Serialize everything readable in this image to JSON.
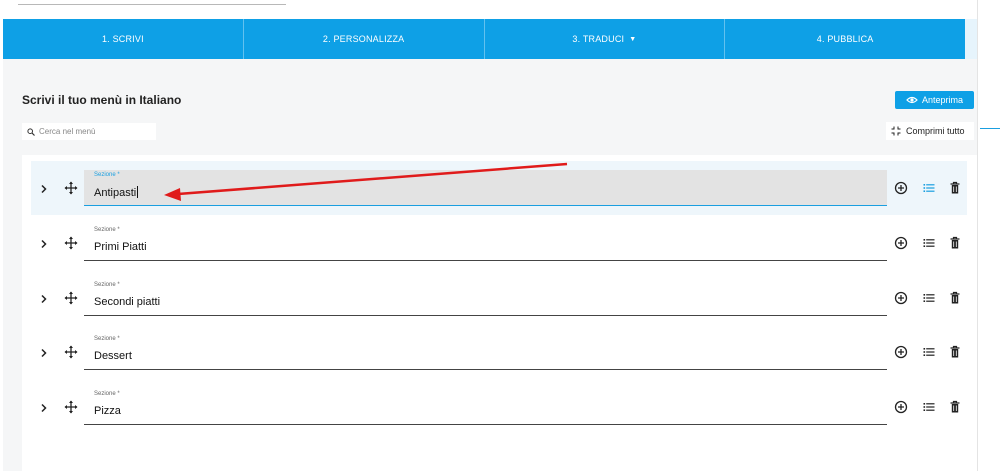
{
  "tabs": [
    {
      "label": "1. SCRIVI",
      "active": true
    },
    {
      "label": "2. PERSONALIZZA",
      "active": false
    },
    {
      "label": "3. TRADUCI",
      "active": false,
      "has_caret": true
    },
    {
      "label": "4. PUBBLICA",
      "active": false
    }
  ],
  "header": {
    "title": "Scrivi il tuo menù in Italiano",
    "preview_label": "Anteprima",
    "search_placeholder": "Cerca nel menù",
    "collapse_label": "Comprimi tutto"
  },
  "sections": [
    {
      "label": "Sezione *",
      "value": "Antipasti",
      "active": true
    },
    {
      "label": "Sezione *",
      "value": "Primi Piatti",
      "active": false
    },
    {
      "label": "Sezione *",
      "value": "Secondi piatti",
      "active": false
    },
    {
      "label": "Sezione *",
      "value": "Dessert",
      "active": false
    },
    {
      "label": "Sezione *",
      "value": "Pizza",
      "active": false
    }
  ],
  "colors": {
    "accent": "#0ea0e6",
    "annotation_arrow": "#e01b1b"
  },
  "icons": [
    "search-icon",
    "eye-icon",
    "collapse-icon",
    "chevron-right-icon",
    "move-icon",
    "add-circle-icon",
    "list-icon",
    "trash-icon"
  ]
}
